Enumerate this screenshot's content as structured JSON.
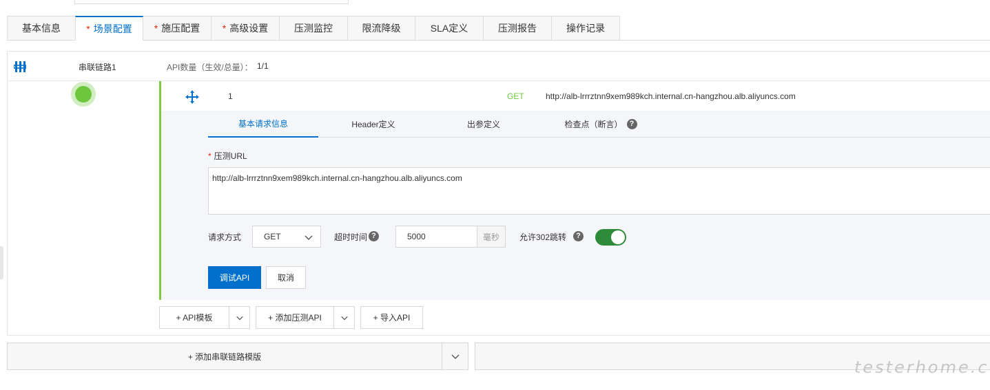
{
  "tabs": [
    {
      "label": "基本信息",
      "required": false,
      "active": false
    },
    {
      "label": "场景配置",
      "required": true,
      "active": true
    },
    {
      "label": "施压配置",
      "required": true,
      "active": false
    },
    {
      "label": "高级设置",
      "required": true,
      "active": false
    },
    {
      "label": "压测监控",
      "required": false,
      "active": false
    },
    {
      "label": "限流降级",
      "required": false,
      "active": false
    },
    {
      "label": "SLA定义",
      "required": false,
      "active": false
    },
    {
      "label": "压测报告",
      "required": false,
      "active": false
    },
    {
      "label": "操作记录",
      "required": false,
      "active": false
    }
  ],
  "required_mark": "*",
  "chain": {
    "name": "串联链路1",
    "api_count_label": "API数量（生效/总量）：",
    "api_count_value": "1/1"
  },
  "api": {
    "index": "1",
    "method": "GET",
    "url": "http://alb-lrrrztnn9xem989kch.internal.cn-hangzhou.alb.aliyuncs.com"
  },
  "subtabs": [
    "基本请求信息",
    "Header定义",
    "出参定义",
    "检查点（断言）"
  ],
  "form": {
    "url_label": "压测URL",
    "url_value": "http://alb-lrrrztnn9xem989kch.internal.cn-hangzhou.alb.aliyuncs.com",
    "method_label": "请求方式",
    "method_value": "GET",
    "timeout_label": "超时时间",
    "timeout_value": "5000",
    "timeout_unit": "毫秒",
    "redirect_label": "允许302跳转",
    "redirect_enabled": true,
    "debug_button": "调试API",
    "cancel_button": "取消"
  },
  "actions": {
    "api_template": "+ API模板",
    "add_api": "+ 添加压测API",
    "import_api": "+ 导入API",
    "add_chain_template": "+ 添加串联链路模版"
  },
  "colors": {
    "primary": "#0070cc",
    "success": "#6cc73d",
    "toggle_on": "#2e8b3a",
    "required": "#e42500"
  }
}
